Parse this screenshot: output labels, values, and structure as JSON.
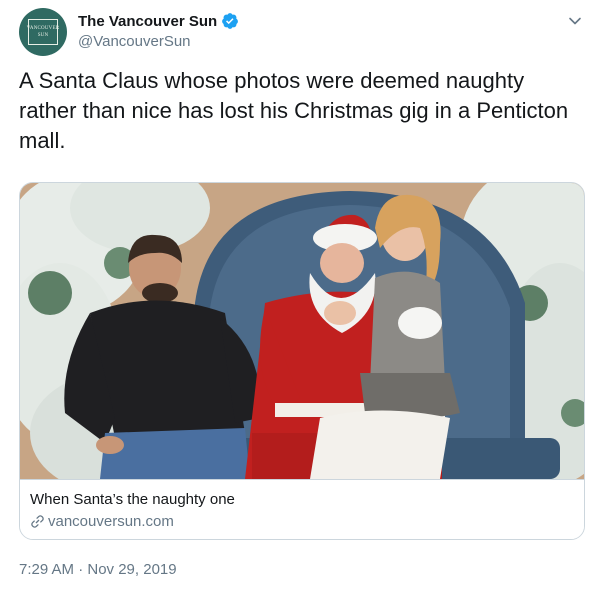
{
  "account": {
    "display_name": "The Vancouver Sun",
    "handle": "@VancouverSun",
    "avatar_text_line1": "VANCOUVER",
    "avatar_text_line2": "SUN",
    "verified": true
  },
  "tweet": {
    "text": "A Santa Claus whose photos were deemed naughty rather than nice has lost his Christmas gig in a Penticton mall."
  },
  "card": {
    "title": "When Santa’s the naughty one",
    "domain": "vancouversun.com",
    "image_icon": "photo-santa-with-couple"
  },
  "meta": {
    "timestamp": "7:29 AM · Nov 29, 2019"
  },
  "icons": {
    "verified": "verified-badge-icon",
    "caret": "chevron-down-icon",
    "link": "link-icon"
  },
  "colors": {
    "verified_blue": "#1da1f2",
    "secondary_text": "#657786",
    "border": "#ccd6dd",
    "avatar_bg": "#2f6a62"
  }
}
